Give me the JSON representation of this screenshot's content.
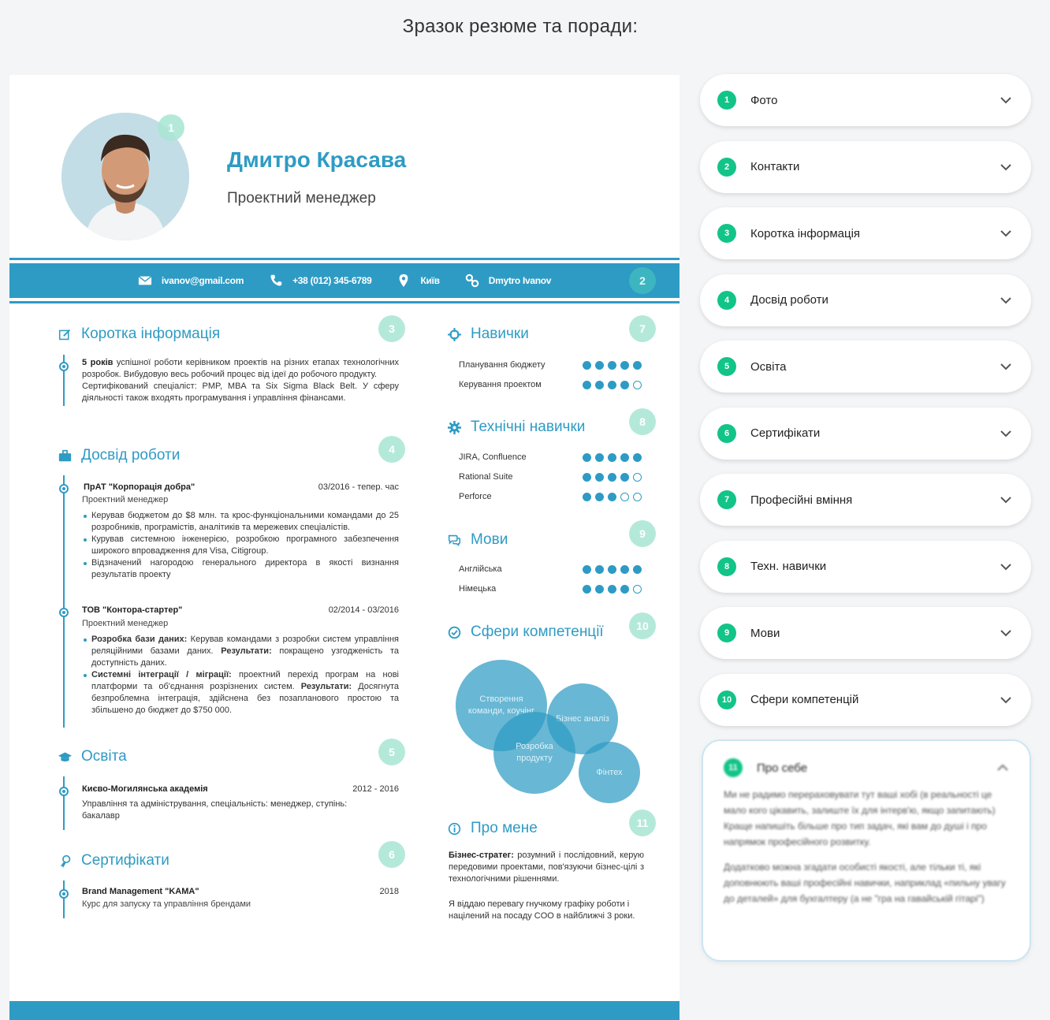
{
  "page_title": "Зразок резюме та поради:",
  "resume": {
    "name": "Дмитро Красава",
    "role": "Проектний менеджер",
    "markers": [
      "1",
      "2",
      "3",
      "4",
      "5",
      "6",
      "7",
      "8",
      "9",
      "10",
      "11"
    ],
    "contacts": {
      "email": "ivanov@gmail.com",
      "phone": "+38 (012) 345-6789",
      "city": "Київ",
      "social": "Dmytro Ivanov"
    },
    "summary": {
      "title": "Коротка інформація",
      "bold": "5 років",
      "text": "успішної роботи керівником проектів на різних етапах технологічних розробок. Вибудовую весь робочий процес від ідеї до робочого продукту.",
      "text2": "Сертифікований спеціаліст: PMP, MBA та Six Sigma Black Belt. У сферу діяльності також входять програмування і управління фінансами."
    },
    "experience": {
      "title": "Досвід роботи",
      "jobs": [
        {
          "company": "ПрАТ \"Корпорація добра\"",
          "dates": "03/2016 - тепер. час",
          "position": "Проектний менеджер",
          "bullets": [
            "Керував бюджетом до $8 млн. та крос-функціональними командами до 25 розробників, програмістів, аналітиків та мережевих спеціалістів.",
            "Курував системною інженерією, розробкою програмного забезпечення широкого впровадження для Visa, Citigroup.",
            "Відзначений нагородою генерального директора в якості визнання результатів проекту"
          ]
        },
        {
          "company": "ТОВ \"Контора-стартер\"",
          "dates": "02/2014 - 03/2016",
          "position": "Проектний менеджер",
          "b1_bold": "Розробка бази даних:",
          "b1_text": "Керував командами з розробки систем управління реляційними базами даних.",
          "b1_bold2": "Результати:",
          "b1_text2": "покращено узгодженість та доступність даних.",
          "b2_bold": "Системні інтеграції / міграції:",
          "b2_text": "проектний перехід програм на нові платформи та об'єднання розрізнених систем.",
          "b2_bold2": "Результати:",
          "b2_text2": "Досягнута безпроблемна інтеграція, здійснена без позапланового простою та збільшено до бюджет до $750 000."
        }
      ]
    },
    "education": {
      "title": "Освіта",
      "school": "Києво-Могилянська академія",
      "dates": "2012 - 2016",
      "details": "Управління та адміністрування, спеціальність: менеджер, ступінь: бакалавр"
    },
    "certificates": {
      "title": "Сертифікати",
      "name": "Brand Management \"KAMA\"",
      "year": "2018",
      "details": "Курс для запуску та управління брендами"
    },
    "skills": {
      "title": "Навички",
      "items": [
        {
          "name": "Планування бюджету",
          "level": 5
        },
        {
          "name": "Керування проектом",
          "level": 4
        }
      ]
    },
    "tech_skills": {
      "title": "Технічні навички",
      "items": [
        {
          "name": "JIRA, Confluence",
          "level": 5
        },
        {
          "name": "Rational Suite",
          "level": 4
        },
        {
          "name": "Perforce",
          "level": 3
        }
      ]
    },
    "languages": {
      "title": "Мови",
      "items": [
        {
          "name": "Англійська",
          "level": 5
        },
        {
          "name": "Німецька",
          "level": 4
        }
      ]
    },
    "competencies": {
      "title": "Сфери компетенції",
      "bubbles": [
        "Створення команди, коучінг",
        "Бізнес аналіз",
        "Розробка продукту",
        "Фінтех"
      ]
    },
    "about": {
      "title": "Про мене",
      "bold": "Бізнес-стратег:",
      "text": "розумний і послідовний, керую передовими проектами, пов'язуючи бізнес-цілі з технологічними рішеннями.",
      "text2": "Я віддаю перевагу гнучкому графіку роботи і націлений на посаду COO в найближчі 3 роки."
    }
  },
  "accordion": {
    "items": [
      {
        "num": "1",
        "label": "Фото"
      },
      {
        "num": "2",
        "label": "Контакти"
      },
      {
        "num": "3",
        "label": "Коротка інформація"
      },
      {
        "num": "4",
        "label": "Досвід роботи"
      },
      {
        "num": "5",
        "label": "Освіта"
      },
      {
        "num": "6",
        "label": "Сертифікати"
      },
      {
        "num": "7",
        "label": "Професійні вміння"
      },
      {
        "num": "8",
        "label": "Техн. навички"
      },
      {
        "num": "9",
        "label": "Мови"
      },
      {
        "num": "10",
        "label": "Сфери компетенцій"
      }
    ],
    "open": {
      "num": "11",
      "label": "Про себе",
      "p1": "Ми не радимо перераховувати тут ваші хобі (в реальності це мало кого цікавить, залиште їх для інтерв'ю, якщо запитають) Краще напишіть більше про тип задач, які вам до душі і про напрямок професійного розвитку.",
      "p2": "Додатково можна згадати особисті якості, але тільки ті, які доповнюють ваші професійні навички, наприклад «пильну увагу до деталей» для бухгалтеру (а не \"гра на гавайській гітарі\")"
    }
  },
  "colors": {
    "accent": "#2e9bc4",
    "badge": "#12c488",
    "marker": "#a8e6d4"
  }
}
